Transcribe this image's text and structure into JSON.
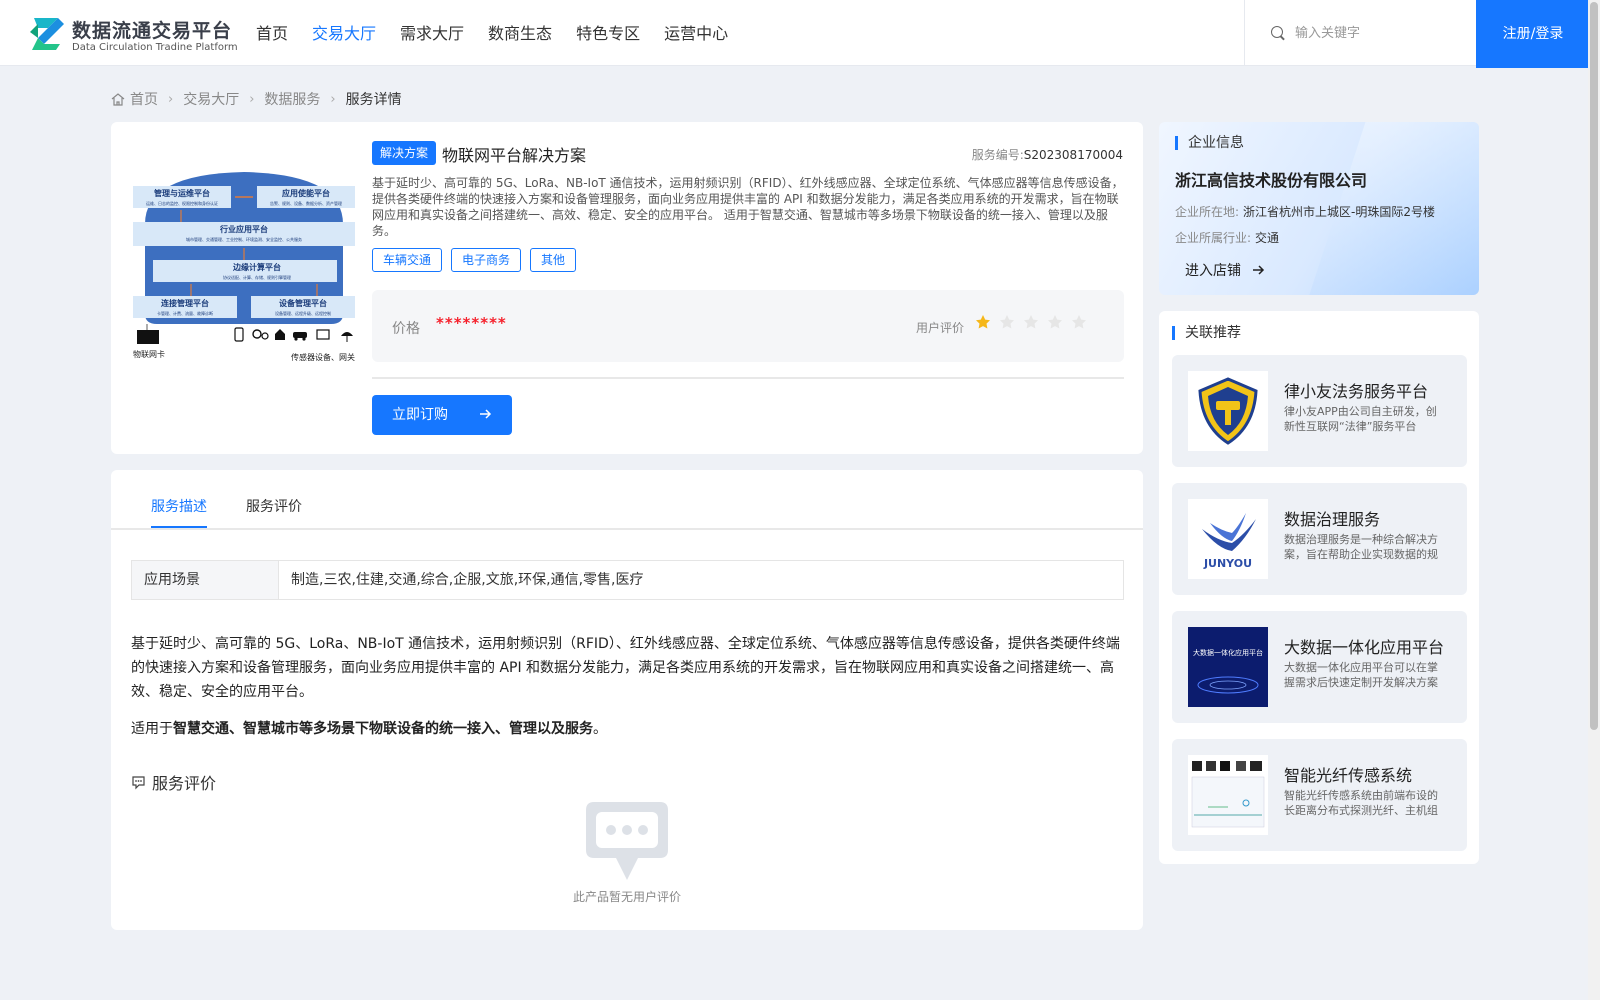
{
  "header": {
    "logo_title": "数据流通交易平台",
    "logo_subtitle": "Data Circulation Tradine Platform",
    "nav": [
      "首页",
      "交易大厅",
      "需求大厅",
      "数商生态",
      "特色专区",
      "运营中心"
    ],
    "active_nav_index": 1,
    "search_placeholder": "输入关键字",
    "login_label": "注册/登录"
  },
  "breadcrumb": [
    "首页",
    "交易大厅",
    "数据服务",
    "服务详情"
  ],
  "product": {
    "category_tag": "解决方案",
    "title": "物联网平台解决方案",
    "service_no_label": "服务编号:",
    "service_no": "S202308170004",
    "description": "基于延时少、高可靠的 5G、LoRa、NB-IoT 通信技术，运用射频识别（RFID）、红外线感应器、全球定位系统、气体感应器等信息传感设备，提供各类硬件终端的快速接入方案和设备管理服务，面向业务应用提供丰富的 API 和数据分发能力，满足各类应用系统的开发需求，旨在物联网应用和真实设备之间搭建统一、高效、稳定、安全的应用平台。 适用于智慧交通、智慧城市等多场景下物联设备的统一接入、管理以及服务。",
    "tags": [
      "车辆交通",
      "电子商务",
      "其他"
    ],
    "price_label": "价格",
    "price_value": "********",
    "rating_label": "用户评价",
    "rating": 1,
    "rating_max": 5,
    "order_label": "立即订购",
    "image_labels": {
      "top_left": "管理与运维平台",
      "top_left_sub": "运维、日志的监控、权限控制和身份认证",
      "top_right": "应用使能平台",
      "top_right_sub": "告警、规则、设备、数据分析、资产管理",
      "middle": "行业应用平台",
      "middle_sub": "城市管理、交通管理、工业控制、环境监测、安全监控、公共服务",
      "edge": "边缘计算平台",
      "edge_sub": "协议适配、计算、存储、规则引擎管理",
      "conn": "连接管理平台",
      "conn_sub": "卡管理、计费、流量、故障诊断",
      "device": "设备管理平台",
      "device_sub": "设备管理、远程升级、远程控制",
      "sim": "物联网卡",
      "sensors": "传感器设备、网关"
    }
  },
  "company": {
    "section_title": "企业信息",
    "name": "浙江高信技术股份有限公司",
    "location_label": "企业所在地:",
    "location": "浙江省杭州市上城区-明珠国际2号楼",
    "industry_label": "企业所属行业:",
    "industry": "交通",
    "enter_shop": "进入店铺"
  },
  "recommend": {
    "section_title": "关联推荐",
    "items": [
      {
        "title": "律小友法务服务平台",
        "desc": "律小友APP由公司自主研发，创新性互联网“法律”服务平台"
      },
      {
        "title": "数据治理服务",
        "desc": "数据治理服务是一种综合解决方案，旨在帮助企业实现数据的规范化管理"
      },
      {
        "title": "大数据一体化应用平台",
        "desc": "大数据一体化应用平台可以在掌握需求后快速定制开发解决方案"
      },
      {
        "title": "智能光纤传感系统",
        "desc": "智能光纤传感系统由前端布设的长距离分布式探测光纤、主机组成"
      }
    ],
    "thumb_texts": {
      "junyou": "JUNYOU",
      "bigdata": "大数据一体化应用平台"
    }
  },
  "detail": {
    "tabs": [
      "服务描述",
      "服务评价"
    ],
    "active_tab_index": 0,
    "scene_label": "应用场景",
    "scene_value": "制造,三农,住建,交通,综合,企服,文旅,环保,通信,零售,医疗",
    "body": "基于延时少、高可靠的 5G、LoRa、NB-IoT 通信技术，运用射频识别（RFID）、红外线感应器、全球定位系统、气体感应器等信息传感设备，提供各类硬件终端的快速接入方案和设备管理服务，面向业务应用提供丰富的 API 和数据分发能力，满足各类应用系统的开发需求，旨在物联网应用和真实设备之间搭建统一、高效、稳定、安全的应用平台。",
    "apply_prefix": "适用于",
    "apply_bold": "智慧交通、智慧城市等多场景下物联设备的统一接入、管理以及服务",
    "apply_suffix": "。",
    "review_title": "服务评价",
    "empty_text": "此产品暂无用户评价"
  },
  "colors": {
    "primary": "#1677ff",
    "price": "#f5222d",
    "star_on": "#f5b71a",
    "star_off": "#e6e6e6"
  }
}
